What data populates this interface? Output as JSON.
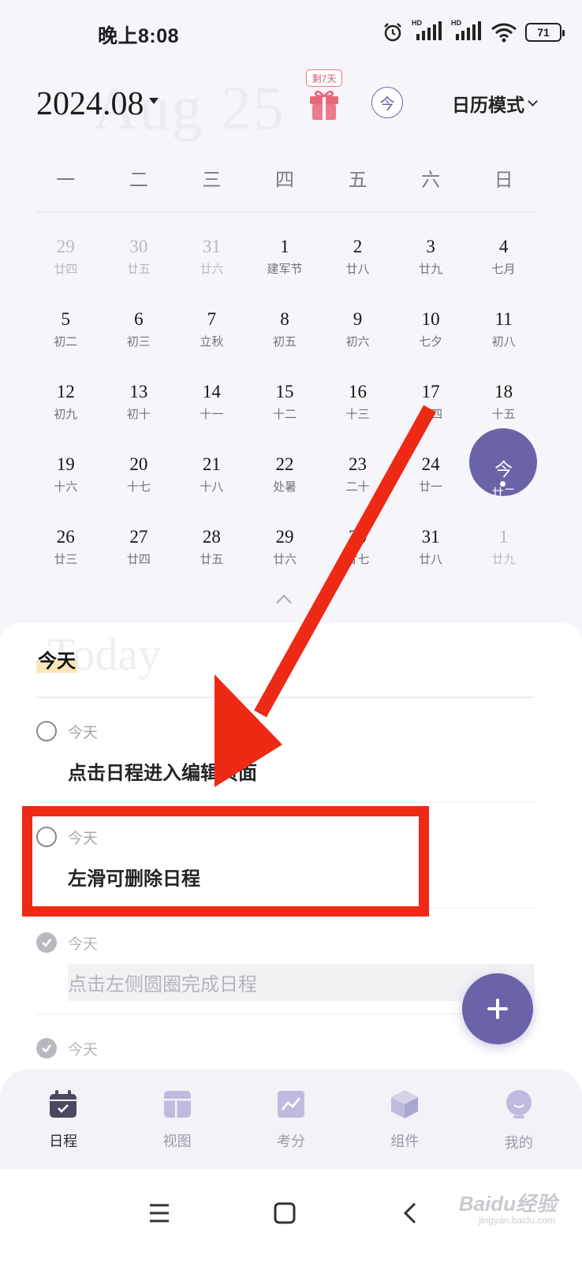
{
  "status_bar": {
    "time": "晚上8:08",
    "battery": "71",
    "hd": "HD"
  },
  "header": {
    "month": "2024.08",
    "ghost_text": "Aug 25",
    "gift_badge": "剩7天",
    "today_button": "今",
    "mode_label": "日历模式"
  },
  "weekdays": [
    "一",
    "二",
    "三",
    "四",
    "五",
    "六",
    "日"
  ],
  "calendar": {
    "weeks": [
      [
        {
          "n": "29",
          "l": "廿四",
          "muted": true
        },
        {
          "n": "30",
          "l": "廿五",
          "muted": true
        },
        {
          "n": "31",
          "l": "廿六",
          "muted": true
        },
        {
          "n": "1",
          "l": "建军节"
        },
        {
          "n": "2",
          "l": "廿八"
        },
        {
          "n": "3",
          "l": "廿九"
        },
        {
          "n": "4",
          "l": "七月"
        }
      ],
      [
        {
          "n": "5",
          "l": "初二"
        },
        {
          "n": "6",
          "l": "初三"
        },
        {
          "n": "7",
          "l": "立秋"
        },
        {
          "n": "8",
          "l": "初五"
        },
        {
          "n": "9",
          "l": "初六"
        },
        {
          "n": "10",
          "l": "七夕"
        },
        {
          "n": "11",
          "l": "初八"
        }
      ],
      [
        {
          "n": "12",
          "l": "初九"
        },
        {
          "n": "13",
          "l": "初十"
        },
        {
          "n": "14",
          "l": "十一"
        },
        {
          "n": "15",
          "l": "十二"
        },
        {
          "n": "16",
          "l": "十三"
        },
        {
          "n": "17",
          "l": "十四"
        },
        {
          "n": "18",
          "l": "十五"
        }
      ],
      [
        {
          "n": "19",
          "l": "十六"
        },
        {
          "n": "20",
          "l": "十七"
        },
        {
          "n": "21",
          "l": "十八"
        },
        {
          "n": "22",
          "l": "处暑"
        },
        {
          "n": "23",
          "l": "二十"
        },
        {
          "n": "24",
          "l": "廿一"
        },
        {
          "n": "今",
          "l": "廿二",
          "today": true
        }
      ],
      [
        {
          "n": "26",
          "l": "廿三"
        },
        {
          "n": "27",
          "l": "廿四"
        },
        {
          "n": "28",
          "l": "廿五"
        },
        {
          "n": "29",
          "l": "廿六"
        },
        {
          "n": "30",
          "l": "廿七"
        },
        {
          "n": "31",
          "l": "廿八"
        },
        {
          "n": "1",
          "l": "廿九",
          "muted": true
        }
      ]
    ]
  },
  "list": {
    "ghost_text": "Today",
    "section_label": "今天",
    "tasks": [
      {
        "date": "今天",
        "title": "点击日程进入编辑页面",
        "done": false
      },
      {
        "date": "今天",
        "title": "左滑可删除日程",
        "done": false
      },
      {
        "date": "今天",
        "title": "点击左侧圆圈完成日程",
        "done": true
      },
      {
        "date": "今天",
        "title": "",
        "done": true
      }
    ]
  },
  "tabs": [
    {
      "label": "日程",
      "icon": "calendar-icon",
      "active": true
    },
    {
      "label": "视图",
      "icon": "view-icon",
      "active": false
    },
    {
      "label": "考分",
      "icon": "chart-icon",
      "active": false
    },
    {
      "label": "组件",
      "icon": "cube-icon",
      "active": false
    },
    {
      "label": "我的",
      "icon": "avatar-icon",
      "active": false
    }
  ],
  "colors": {
    "accent": "#6a63a8",
    "annotation": "#ee2a15",
    "gift": "#e8677a"
  },
  "watermark": {
    "main": "Baidu经验",
    "sub": "jingyan.baidu.com"
  }
}
